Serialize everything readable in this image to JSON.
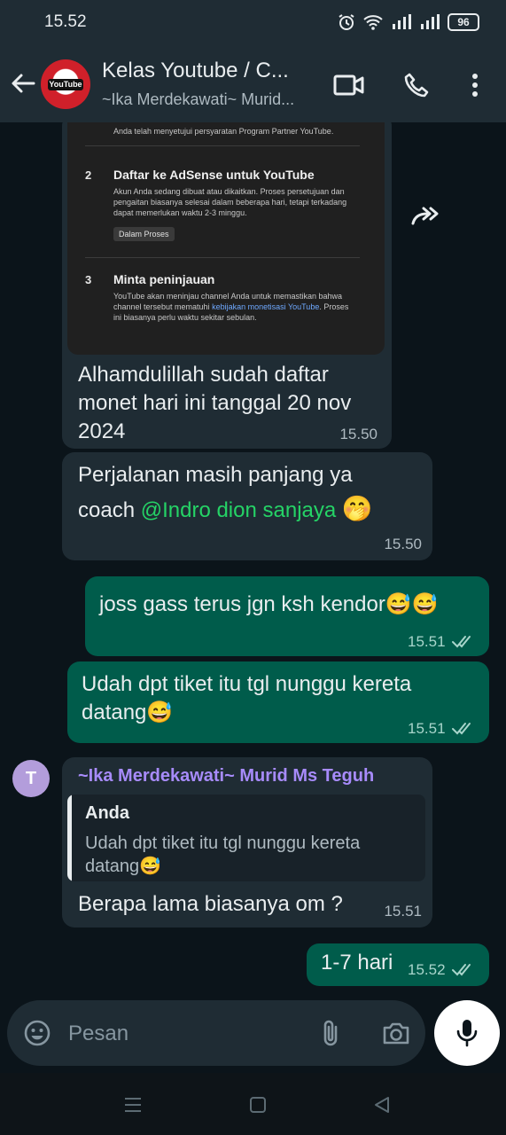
{
  "status_bar": {
    "time": "15.52",
    "battery": "96"
  },
  "header": {
    "title": "Kelas Youtube / C...",
    "subtitle": "~Ika Merdekawati~ Murid...",
    "avatar_text": "YouTube"
  },
  "shared_screenshot": {
    "line_top": "Anda telah menyetujui persyaratan Program Partner YouTube.",
    "step2_num": "2",
    "step2_title": "Daftar ke AdSense untuk YouTube",
    "step2_desc_1": "Akun Anda sedang dibuat atau dikaitkan. Proses persetujuan dan",
    "step2_desc_2": "pengaitan biasanya selesai dalam beberapa hari, tetapi terkadang",
    "step2_desc_3": "dapat memerlukan waktu 2-3 minggu.",
    "step2_chip": "Dalam Proses",
    "step3_num": "3",
    "step3_title": "Minta peninjauan",
    "step3_desc_1": "YouTube akan meninjau channel Anda untuk memastikan bahwa",
    "step3_desc_2a": "channel tersebut mematuhi ",
    "step3_desc_2_link": "kebijakan monetisasi YouTube",
    "step3_desc_2b": ". Proses",
    "step3_desc_3": "ini biasanya perlu waktu sekitar sebulan."
  },
  "messages": [
    {
      "text_1": "Alhamdulillah sudah daftar",
      "text_2": "monet hari ini tanggal 20 nov",
      "text_3": "2024",
      "time": "15.50"
    },
    {
      "text_1": "Perjalanan masih panjang ya",
      "text_2a": "coach ",
      "mention": "@Indro dion sanjaya",
      "emoji": "🤭",
      "time": "15.50"
    },
    {
      "text": "joss gass terus jgn ksh kendor😅😅",
      "time": "15.51"
    },
    {
      "text_1": "Udah dpt tiket itu tgl nunggu kereta",
      "text_2": "datang😅",
      "time": "15.51"
    },
    {
      "avatar": "T",
      "sender": "~Ika Merdekawati~ Murid Ms Teguh",
      "quote_name": "Anda",
      "quote_text_1": "Udah dpt tiket itu tgl nunggu kereta",
      "quote_text_2": "datang😅",
      "text": "Berapa lama biasanya om ?",
      "time": "15.51"
    },
    {
      "text": "1-7 hari",
      "time": "15.52"
    }
  ],
  "composer": {
    "placeholder": "Pesan"
  },
  "colors": {
    "incoming": "#1f2c34",
    "outgoing": "#005c4b",
    "mention": "#25d366",
    "sender": "#a78bfa"
  },
  "icons": [
    "back-arrow-icon",
    "video-call-icon",
    "phone-call-icon",
    "more-vert-icon",
    "forward-icon",
    "emoji-icon",
    "attach-icon",
    "camera-icon",
    "mic-icon",
    "double-check-icon"
  ]
}
